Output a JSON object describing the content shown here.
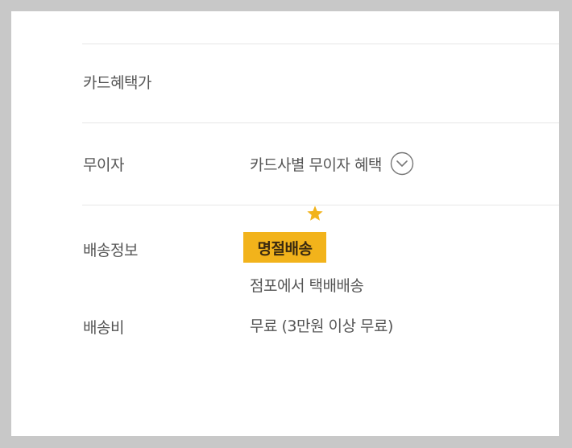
{
  "rows": {
    "card_benefit": {
      "label": "카드혜택가"
    },
    "interest_free": {
      "label": "무이자",
      "value": "카드사별 무이자 혜택"
    },
    "shipping_info": {
      "label": "배송정보",
      "badge": "명절배송",
      "detail": "점포에서 택배배송"
    },
    "shipping_fee": {
      "label": "배송비",
      "value": "무료 (3만원 이상 무료)"
    }
  },
  "icons": {
    "expand": "chevron-down-icon",
    "star": "star-icon"
  },
  "colors": {
    "highlight": "#f2b31b",
    "star": "#f2b31b",
    "text": "#555555",
    "divider": "#e6e6e6"
  }
}
